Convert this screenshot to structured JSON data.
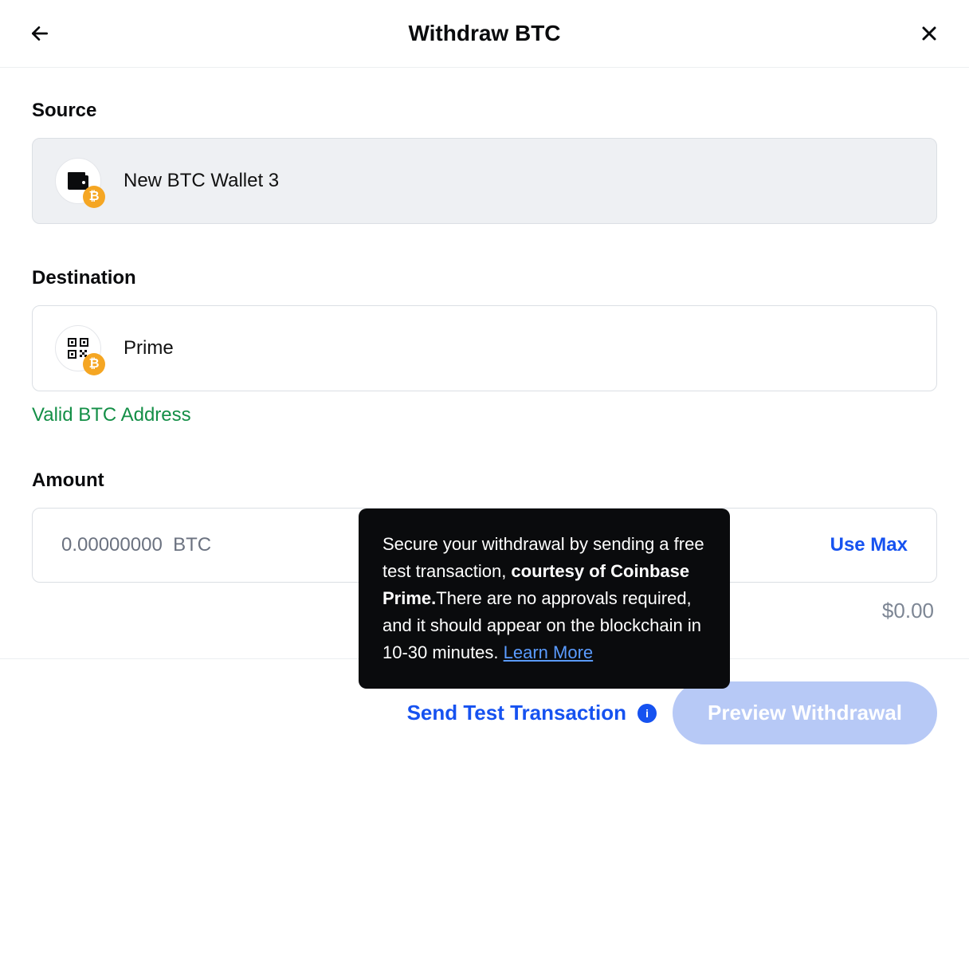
{
  "header": {
    "title": "Withdraw BTC"
  },
  "source": {
    "label": "Source",
    "wallet_name": "New BTC Wallet 3",
    "coin_symbol": "₿"
  },
  "destination": {
    "label": "Destination",
    "wallet_name": "Prime",
    "coin_symbol": "₿",
    "validation_text": "Valid BTC Address"
  },
  "amount": {
    "label": "Amount",
    "value": "0.00000000",
    "unit": "BTC",
    "use_max_label": "Use Max",
    "fiat_display": "$0.00"
  },
  "tooltip": {
    "text1": "Secure your withdrawal by sending a free test transaction, ",
    "bold": "courtesy of Coinbase Prime.",
    "text2": "There are no approvals required, and it should appear on the blockchain in 10-30 minutes. ",
    "link_label": "Learn More"
  },
  "footer": {
    "test_label": "Send Test Transaction",
    "info_glyph": "i",
    "preview_label": "Preview Withdrawal"
  }
}
